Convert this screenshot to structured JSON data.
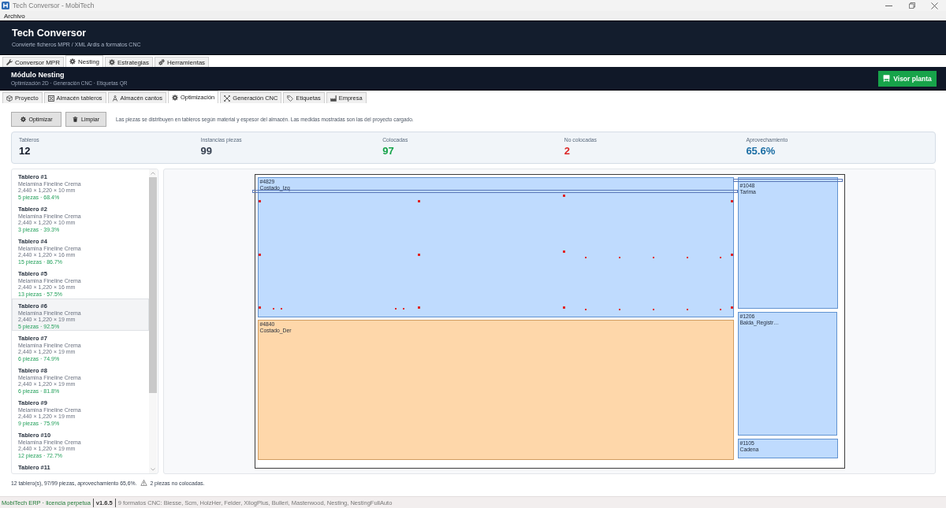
{
  "window": {
    "title": "Tech Conversor - MobiTech"
  },
  "menu_bar": [
    "Archivo"
  ],
  "header": {
    "title": "Tech Conversor",
    "subtitle": "Convierte ficheros MPR / XML Ardis a formatos CNC"
  },
  "main_tabs": [
    {
      "label": "Conversor MPR",
      "selected": false
    },
    {
      "label": "Nesting",
      "selected": true
    },
    {
      "label": "Estrategias",
      "selected": false
    },
    {
      "label": "Herramientas",
      "selected": false
    }
  ],
  "module_header": {
    "title": "Módulo Nesting",
    "subtitle": "Optimización 2D · Generación CNC · Etiquetas QR",
    "button": "Visor planta"
  },
  "sub_tabs": [
    {
      "label": "Proyecto",
      "selected": false
    },
    {
      "label": "Almacén tableros",
      "selected": false
    },
    {
      "label": "Almacén cantos",
      "selected": false
    },
    {
      "label": "Optimización",
      "selected": true
    },
    {
      "label": "Generación CNC",
      "selected": false
    },
    {
      "label": "Etiquetas",
      "selected": false
    },
    {
      "label": "Empresa",
      "selected": false
    }
  ],
  "toolbar": {
    "buttons": [
      "Optimizar",
      "Limpiar"
    ],
    "info": "Las piezas se distribuyen en tableros según material y espesor del almacén. Las medidas mostradas son las del proyecto cargado."
  },
  "stats": [
    {
      "label": "Tableros",
      "value": "12",
      "color": "#111827"
    },
    {
      "label": "Instancias piezas",
      "value": "99",
      "color": "#374151"
    },
    {
      "label": "Colocadas",
      "value": "97",
      "color": "#16a34a"
    },
    {
      "label": "No colocadas",
      "value": "2",
      "color": "#dc2626"
    },
    {
      "label": "Aprovechamiento",
      "value": "65.6%",
      "color": "#1d6fa5"
    }
  ],
  "boards": [
    {
      "title": "Tablero #1",
      "material": "Melamina Fineline Crema",
      "dimensions": "2,440 × 1,220 × 10 mm",
      "summary": "5 piezas · 68.4%",
      "selected": false
    },
    {
      "title": "Tablero #2",
      "material": "Melamina Fineline Crema",
      "dimensions": "2,440 × 1,220 × 10 mm",
      "summary": "3 piezas · 39.3%",
      "selected": false
    },
    {
      "title": "Tablero #4",
      "material": "Melamina Fineline Crema",
      "dimensions": "2,440 × 1,220 × 16 mm",
      "summary": "15 piezas · 86.7%",
      "selected": false
    },
    {
      "title": "Tablero #5",
      "material": "Melamina Fineline Crema",
      "dimensions": "2,440 × 1,220 × 16 mm",
      "summary": "13 piezas · 57.5%",
      "selected": false
    },
    {
      "title": "Tablero #6",
      "material": "Melamina Fineline Crema",
      "dimensions": "2,440 × 1,220 × 19 mm",
      "summary": "5 piezas · 92.5%",
      "selected": true
    },
    {
      "title": "Tablero #7",
      "material": "Melamina Fineline Crema",
      "dimensions": "2,440 × 1,220 × 19 mm",
      "summary": "6 piezas · 74.9%",
      "selected": false
    },
    {
      "title": "Tablero #8",
      "material": "Melamina Fineline Crema",
      "dimensions": "2,440 × 1,220 × 19 mm",
      "summary": "6 piezas · 81.8%",
      "selected": false
    },
    {
      "title": "Tablero #9",
      "material": "Melamina Fineline Crema",
      "dimensions": "2,440 × 1,220 × 19 mm",
      "summary": "9 piezas · 75.9%",
      "selected": false
    },
    {
      "title": "Tablero #10",
      "material": "Melamina Fineline Crema",
      "dimensions": "2,440 × 1,220 × 19 mm",
      "summary": "12 piezas · 72.7%",
      "selected": false
    },
    {
      "title": "Tablero #11",
      "selected": false
    }
  ],
  "layout": {
    "pieces": [
      {
        "id": "#4829",
        "name": "Costado_Izq",
        "color": "#bfdbfe"
      },
      {
        "id": "#4840",
        "name": "Costado_Der",
        "color": "#fed7aa"
      },
      {
        "id": "#1048",
        "name": "Tarima",
        "color": "#bfdbfe"
      },
      {
        "id": "#1206",
        "name": "Balda_Registr…",
        "color": "#bfdbfe"
      },
      {
        "id": "#1105",
        "name": "Cadena",
        "color": "#bfdbfe"
      }
    ]
  },
  "status_line": {
    "summary": "12 tablero(s), 97/99 piezas, aprovechamiento 65,6%.",
    "warning": "2 piezas no colocadas."
  },
  "status_bar": {
    "license": "MobiTech ERP · licencia perpetua",
    "version": "v1.6.5",
    "formats": "9 formatos CNC: Biesse, Scm, HolzHer, Felder, XilogPlus, Bulleri, Masterwood, Nesting, NestingFullAuto"
  }
}
